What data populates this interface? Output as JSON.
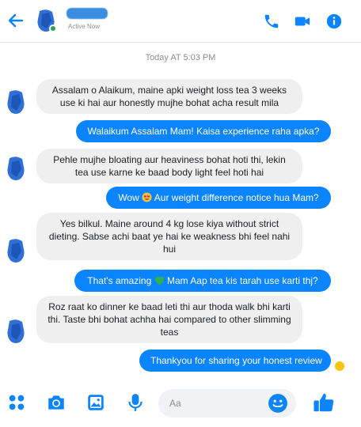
{
  "header": {
    "status": "Active Now"
  },
  "timestamp": "Today AT 5:03 PM",
  "messages": [
    {
      "lines": [
        "Assalam o Alaikum, maine apki weight loss tea 3 weeks",
        "use ki hai aur honestly mujhe bohat acha result mila"
      ]
    },
    {
      "text": "Walaikum Assalam Mam! Kaisa experience raha apka?"
    },
    {
      "lines": [
        "Pehle mujhe bloating aur heaviness bohat hoti thi, lekin",
        "tea use karne ke baad body light feel hoti hai"
      ]
    },
    {
      "before": "Wow ",
      "after": " Aur weight difference notice hua Mam?",
      "emoji": "heart-eyes"
    },
    {
      "lines": [
        "Yes bilkul. Maine around 4 kg lose kiya without strict",
        "dieting. Sabse achi baat ye hai ke weakness bhi feel nahi",
        "hui"
      ]
    },
    {
      "before": "That's amazing ",
      "after": " Mam Aap tea kis tarah use karti thj?",
      "emoji": "green-heart"
    },
    {
      "lines": [
        "Roz raat ko dinner ke baad leti thi aur thoda walk bhi karti",
        "thi. Taste bhi bohat achha hai compared to other slimming",
        "teas"
      ]
    },
    {
      "text": "Thankyou for sharing your honest review"
    }
  ],
  "composer": {
    "placeholder": "Aa"
  },
  "colors": {
    "accent": "#0b84ff",
    "received_bubble": "#efefef",
    "online": "#31a24c"
  }
}
